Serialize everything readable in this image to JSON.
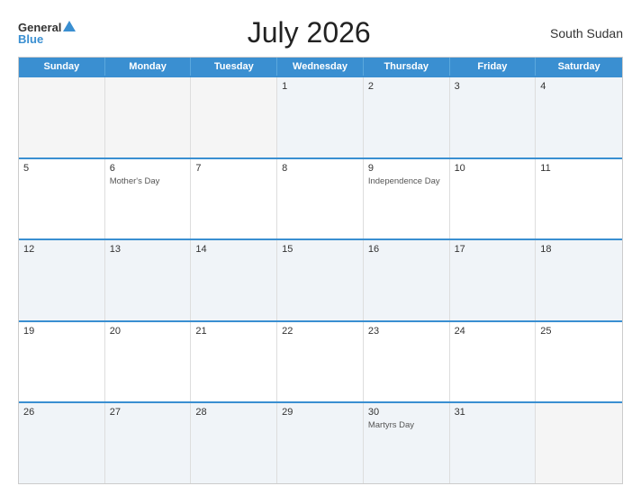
{
  "header": {
    "logo_general": "General",
    "logo_blue": "Blue",
    "title": "July 2026",
    "country": "South Sudan"
  },
  "calendar": {
    "days_of_week": [
      "Sunday",
      "Monday",
      "Tuesday",
      "Wednesday",
      "Thursday",
      "Friday",
      "Saturday"
    ],
    "weeks": [
      [
        {
          "day": "",
          "empty": true
        },
        {
          "day": "",
          "empty": true
        },
        {
          "day": "",
          "empty": true
        },
        {
          "day": "1",
          "event": ""
        },
        {
          "day": "2",
          "event": ""
        },
        {
          "day": "3",
          "event": ""
        },
        {
          "day": "4",
          "event": ""
        }
      ],
      [
        {
          "day": "5",
          "event": ""
        },
        {
          "day": "6",
          "event": "Mother's Day"
        },
        {
          "day": "7",
          "event": ""
        },
        {
          "day": "8",
          "event": ""
        },
        {
          "day": "9",
          "event": "Independence Day"
        },
        {
          "day": "10",
          "event": ""
        },
        {
          "day": "11",
          "event": ""
        }
      ],
      [
        {
          "day": "12",
          "event": ""
        },
        {
          "day": "13",
          "event": ""
        },
        {
          "day": "14",
          "event": ""
        },
        {
          "day": "15",
          "event": ""
        },
        {
          "day": "16",
          "event": ""
        },
        {
          "day": "17",
          "event": ""
        },
        {
          "day": "18",
          "event": ""
        }
      ],
      [
        {
          "day": "19",
          "event": ""
        },
        {
          "day": "20",
          "event": ""
        },
        {
          "day": "21",
          "event": ""
        },
        {
          "day": "22",
          "event": ""
        },
        {
          "day": "23",
          "event": ""
        },
        {
          "day": "24",
          "event": ""
        },
        {
          "day": "25",
          "event": ""
        }
      ],
      [
        {
          "day": "26",
          "event": ""
        },
        {
          "day": "27",
          "event": ""
        },
        {
          "day": "28",
          "event": ""
        },
        {
          "day": "29",
          "event": ""
        },
        {
          "day": "30",
          "event": "Martyrs Day"
        },
        {
          "day": "31",
          "event": ""
        },
        {
          "day": "",
          "empty": true
        }
      ]
    ]
  }
}
